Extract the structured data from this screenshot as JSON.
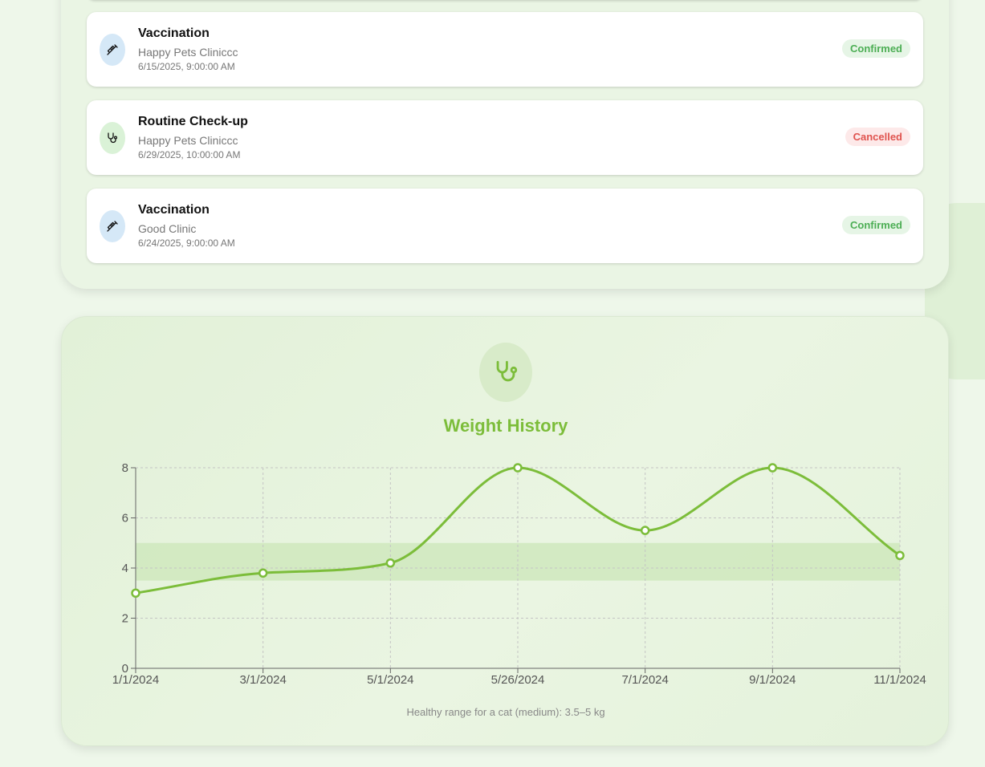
{
  "appointments": [
    {
      "type": "Vaccination",
      "clinic": "Happy Pets Cliniccc",
      "date": "6/15/2025, 9:00:00 AM",
      "status": "Confirmed",
      "icon": "syringe-icon"
    },
    {
      "type": "Routine Check-up",
      "clinic": "Happy Pets Cliniccc",
      "date": "6/29/2025, 10:00:00 AM",
      "status": "Cancelled",
      "icon": "stethoscope-icon"
    },
    {
      "type": "Vaccination",
      "clinic": "Good Clinic",
      "date": "6/24/2025, 9:00:00 AM",
      "status": "Confirmed",
      "icon": "syringe-icon"
    }
  ],
  "weight_history": {
    "title": "Weight History",
    "icon": "stethoscope-icon",
    "caption": "Healthy range for a cat (medium): 3.5–5 kg"
  },
  "colors": {
    "accent": "#7cbd3a",
    "confirmed": "#4cae54",
    "cancelled": "#e0544f",
    "healthy_band": "#cfe8bd"
  },
  "chart_data": {
    "type": "line",
    "x": [
      "1/1/2024",
      "3/1/2024",
      "5/1/2024",
      "5/26/2024",
      "7/1/2024",
      "9/1/2024",
      "11/1/2024"
    ],
    "series": [
      {
        "values": [
          3,
          3.8,
          4.2,
          8,
          5.5,
          8,
          4.5
        ]
      }
    ],
    "ylim": [
      0,
      8
    ],
    "yticks": [
      0,
      2,
      4,
      6,
      8
    ],
    "healthy_range": [
      3.5,
      5
    ],
    "grid": true
  }
}
